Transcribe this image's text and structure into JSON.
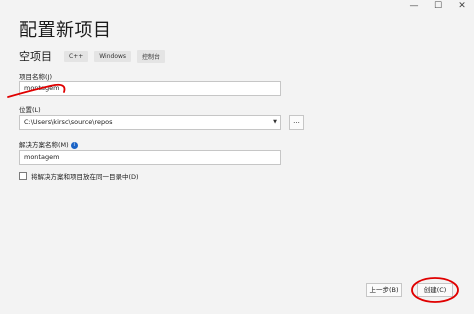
{
  "window": {
    "minimize": "—",
    "maximize": "☐",
    "close": "✕"
  },
  "title": "配置新项目",
  "subtitle": "空项目",
  "tags": [
    "C++",
    "Windows",
    "控制台"
  ],
  "project_name": {
    "label": "项目名称(J)",
    "value": "montagem"
  },
  "location": {
    "label": "位置(L)",
    "value": "C:\\Users\\kirsc\\source\\repos",
    "browse_label": "..."
  },
  "solution_name": {
    "label": "解决方案名称(M)",
    "value": "montagem"
  },
  "same_dir": {
    "label": "将解决方案和项目放在同一目录中(D)",
    "checked": false
  },
  "buttons": {
    "back": "上一步(B)",
    "create": "创建(C)"
  },
  "annotation_color": "#e00000"
}
